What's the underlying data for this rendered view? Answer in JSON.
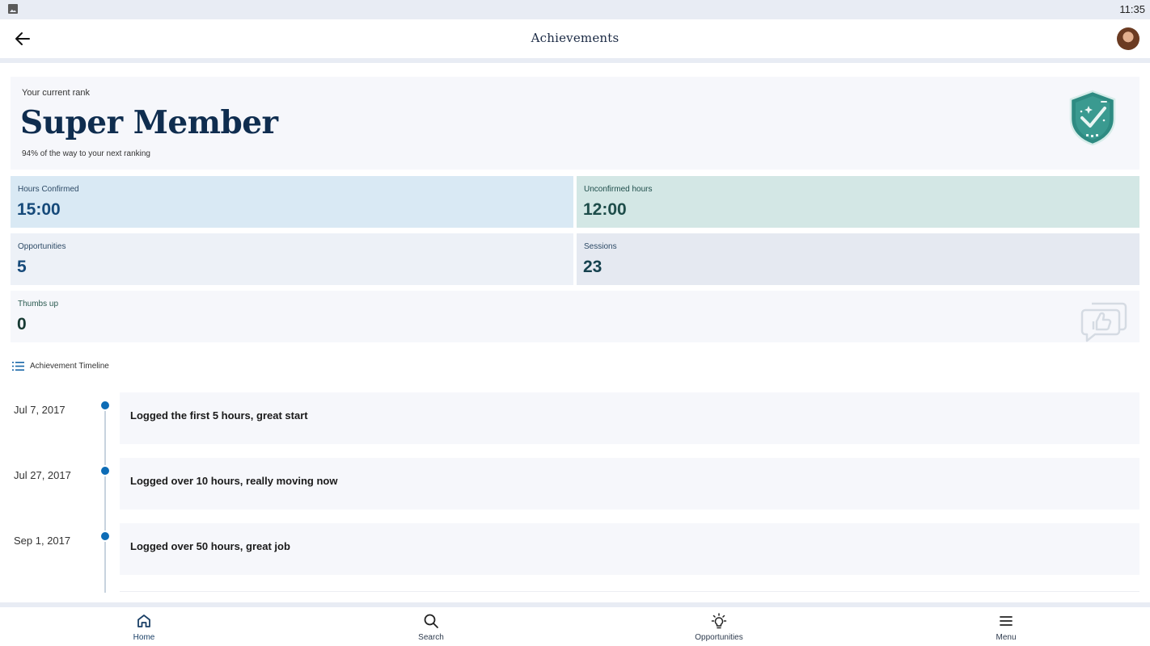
{
  "status_bar": {
    "time": "11:35",
    "left_icon": "image-icon"
  },
  "app_bar": {
    "title": "Achievements",
    "back_icon": "back-arrow-icon",
    "avatar_icon": "avatar"
  },
  "rank": {
    "label": "Your current rank",
    "name": "Super Member",
    "progress_text": "94% of the way to your next ranking",
    "progress_percent": 94,
    "badge_icon": "shield-check-badge-icon"
  },
  "stats": {
    "hours_confirmed": {
      "label": "Hours Confirmed",
      "value": "15:00"
    },
    "unconfirmed_hours": {
      "label": "Unconfirmed hours",
      "value": "12:00"
    },
    "opportunities": {
      "label": "Opportunities",
      "value": "5"
    },
    "sessions": {
      "label": "Sessions",
      "value": "23"
    },
    "thumbs_up": {
      "label": "Thumbs up",
      "value": "0",
      "icon": "thumbs-up-chat-icon"
    }
  },
  "timeline": {
    "heading": "Achievement Timeline",
    "heading_icon": "list-icon",
    "items": [
      {
        "date": "Jul 7, 2017",
        "text": "Logged the first 5 hours, great start"
      },
      {
        "date": "Jul 27, 2017",
        "text": "Logged over 10 hours, really moving now"
      },
      {
        "date": "Sep 1, 2017",
        "text": "Logged over 50 hours, great job"
      }
    ]
  },
  "bottom_nav": {
    "items": [
      {
        "label": "Home",
        "icon": "home-icon",
        "active": true
      },
      {
        "label": "Search",
        "icon": "search-icon",
        "active": false
      },
      {
        "label": "Opportunities",
        "icon": "lightbulb-icon",
        "active": false
      },
      {
        "label": "Menu",
        "icon": "menu-icon",
        "active": false
      }
    ]
  },
  "colors": {
    "accent": "#0d6cb6",
    "rank_title": "#0f2d4f",
    "badge_teal": "#2e8b82",
    "hours_confirmed_bg": "#d9e9f4",
    "unconfirmed_bg": "#d3e7e5"
  }
}
